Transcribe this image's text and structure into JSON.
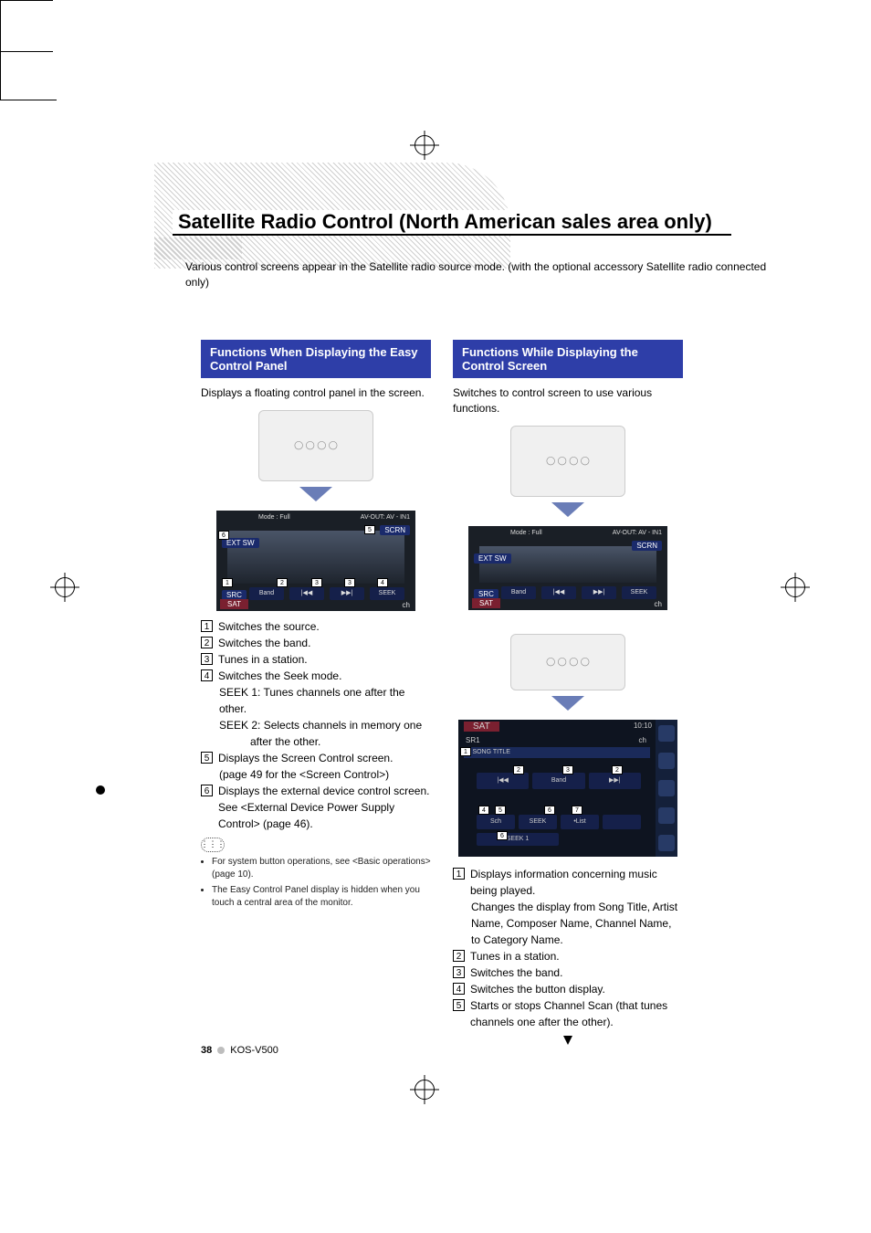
{
  "page_title": "Satellite Radio Control (North American sales area only)",
  "intro": "Various control screens appear in the Satellite radio source mode. (with the optional accessory Satellite radio connected only)",
  "left": {
    "header": "Functions When Displaying the Easy Control Panel",
    "lead": "Displays a floating control panel in the screen.",
    "screenshot": {
      "mode": "Mode : Full",
      "avout": "AV-OUT: AV - IN1",
      "ext_sw": "EXT SW",
      "scrn": "SCRN",
      "sat": "SAT",
      "ch": "ch",
      "buttons": {
        "src": "SRC",
        "band": "Band",
        "prev": "|◀◀",
        "next": "▶▶|",
        "seek": "SEEK"
      }
    },
    "list": [
      {
        "n": "1",
        "text": "Switches the source."
      },
      {
        "n": "2",
        "text": "Switches the band."
      },
      {
        "n": "3",
        "text": "Tunes in a station."
      },
      {
        "n": "4",
        "text": "Switches the Seek mode."
      },
      {
        "n": "5",
        "text": "Displays the Screen Control screen."
      },
      {
        "n": "6",
        "text": "Displays the external device control screen. See <External Device Power Supply Control> (page 46)."
      }
    ],
    "seek_detail": {
      "seek1": "SEEK 1: Tunes channels one after the other.",
      "seek2_a": "SEEK 2: Selects channels in memory one",
      "seek2_b": "after the other."
    },
    "item5_sub": "(page 49 for the <Screen Control>)",
    "notes": [
      "For system button operations, see <Basic operations> (page 10).",
      "The Easy Control Panel display is hidden when you touch a central area of the monitor."
    ]
  },
  "right": {
    "header": "Functions While Displaying the Control Screen",
    "lead": "Switches  to control screen to use various functions.",
    "screenshot": {
      "mode": "Mode : Full",
      "avout": "AV-OUT: AV - IN1",
      "ext_sw": "EXT SW",
      "scrn": "SCRN",
      "sat": "SAT",
      "ch": "ch",
      "src": "SRC",
      "band": "Band",
      "seek": "SEEK"
    },
    "sat_screen": {
      "title": "SAT",
      "time": "10:10",
      "sub": "SR1",
      "ch": "ch",
      "song": "♪  SONG TITLE",
      "mid": {
        "prev": "|◀◀",
        "band": "Band",
        "next": "▶▶|"
      },
      "bot": {
        "sch": "Sch",
        "seek": "SEEK",
        "list": "•List",
        "blank": ""
      },
      "bot2": {
        "seek1": "SEEK 1"
      },
      "callouts": {
        "c1": "1",
        "c2": "2",
        "c3": "3",
        "c4": "4",
        "c5": "5",
        "c6": "6",
        "c7": "7"
      }
    },
    "list": [
      {
        "n": "1",
        "text": "Displays information concerning music being played."
      },
      {
        "n": "2",
        "text": "Tunes in a station."
      },
      {
        "n": "3",
        "text": "Switches the band."
      },
      {
        "n": "4",
        "text": "Switches the button display."
      },
      {
        "n": "5",
        "text": "Starts or stops Channel Scan (that tunes channels one after the other)."
      }
    ],
    "item1_sub": "Changes the display from Song Title, Artist Name, Composer Name, Channel Name, to Category Name."
  },
  "footer": {
    "page": "38",
    "model": "KOS-V500"
  }
}
